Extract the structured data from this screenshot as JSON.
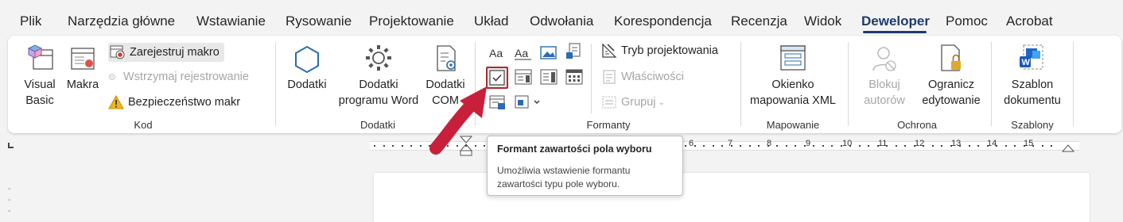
{
  "menu": {
    "tabs": [
      "Plik",
      "Narzędzia główne",
      "Wstawianie",
      "Rysowanie",
      "Projektowanie",
      "Układ",
      "Odwołania",
      "Korespondencja",
      "Recenzja",
      "Widok",
      "Deweloper",
      "Pomoc",
      "Acrobat"
    ],
    "active": "Deweloper"
  },
  "kod": {
    "label": "Kod",
    "visual_basic": "Visual Basic",
    "makra": "Makra",
    "record": "Zarejestruj makro",
    "pause": "Wstrzymaj rejestrowanie",
    "security": "Bezpieczeństwo makr"
  },
  "dodatki": {
    "label": "Dodatki",
    "dodatki": "Dodatki",
    "word_addins": "Dodatki programu Word",
    "com": "Dodatki COM"
  },
  "formanty": {
    "label": "Formanty",
    "design_mode": "Tryb projektowania",
    "properties": "Właściwości",
    "group": "Grupuj"
  },
  "mapowanie": {
    "label": "Mapowanie",
    "xml_pane": "Okienko mapowania XML"
  },
  "ochrona": {
    "label": "Ochrona",
    "block_authors": "Blokuj autorów",
    "restrict": "Ogranicz edytowanie"
  },
  "szablony": {
    "label": "Szablony",
    "template": "Szablon dokumentu"
  },
  "tooltip": {
    "title": "Formant zawartości pola wyboru",
    "description": "Umożliwia wstawienie formantu zawartości typu pole wyboru."
  },
  "ruler": {
    "numbers": [
      "6",
      "7",
      "8",
      "9",
      "10",
      "11",
      "12",
      "13",
      "14",
      "15"
    ]
  },
  "colors": {
    "accent": "#1f3a6e",
    "highlight": "#b3262e",
    "arrow": "#c8203a"
  }
}
